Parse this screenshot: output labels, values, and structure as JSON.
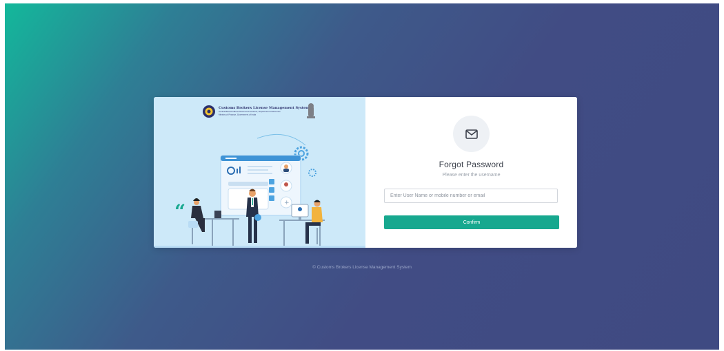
{
  "brand": {
    "title": "Customs Brokers License Management System",
    "line1": "Central Board Indirect Taxes and Customs, Department of Revenue",
    "line2": "Ministry of Finance, Government of India"
  },
  "form": {
    "icon": "mail-icon",
    "title": "Forgot Password",
    "subtitle": "Please enter the username",
    "input_placeholder": "Enter User Name or mobile number or email",
    "input_value": "",
    "confirm_label": "Confirm"
  },
  "footer": {
    "text": "© Customs Brokers License Management System"
  },
  "colors": {
    "accent": "#17a88f",
    "background_start": "#13b89b",
    "background_end": "#414c84",
    "illustration_bg": "#cde9f9"
  }
}
